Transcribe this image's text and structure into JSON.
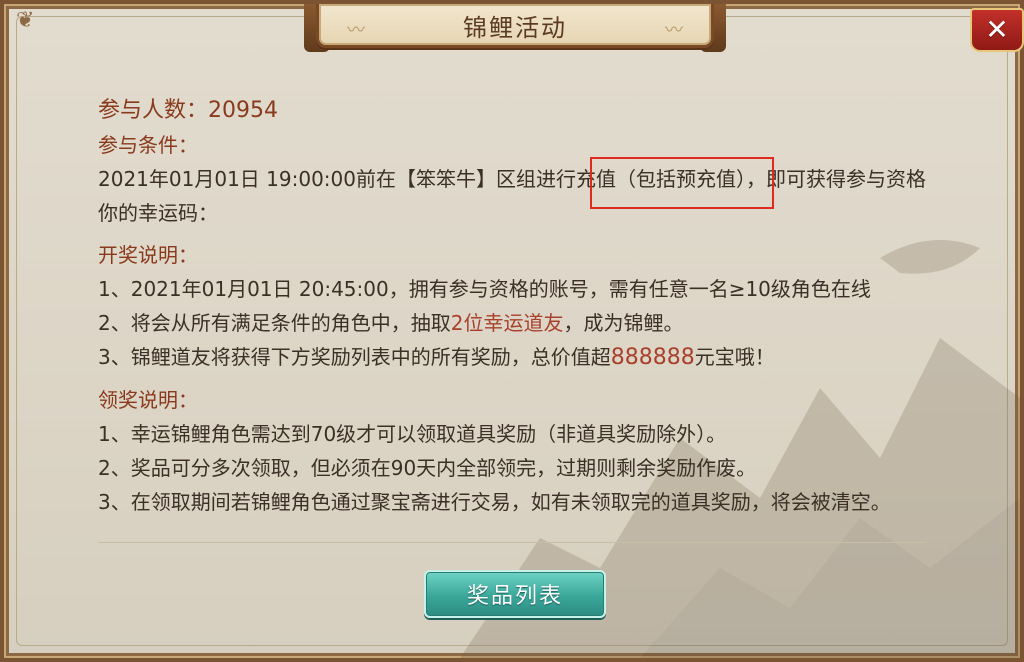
{
  "window": {
    "title": "锦鲤活动",
    "close_icon": "✕"
  },
  "participants": {
    "label": "参与人数：",
    "value": "20954"
  },
  "conditions": {
    "heading": "参与条件：",
    "text_before": "2021年01月01日 19:00:00前在【笨笨牛】区组进行",
    "text_boxed": "充值（包括预充值）",
    "text_after": "，即可获得参与资格",
    "lucky_code": "你的幸运码："
  },
  "draw": {
    "heading": "开奖说明：",
    "line1": "1、2021年01月01日 20:45:00，拥有参与资格的账号，需有任意一名≥10级角色在线",
    "line2_a": "2、将会从所有满足条件的角色中，抽取",
    "line2_hl": "2位幸运道友",
    "line2_b": "，成为锦鲤。",
    "line3_a": "3、锦鲤道友将获得下方奖励列表中的所有奖励，总价值超",
    "line3_hl": "888888",
    "line3_b": "元宝哦！"
  },
  "claim": {
    "heading": "领奖说明：",
    "line1": "1、幸运锦鲤角色需达到70级才可以领取道具奖励（非道具奖励除外）。",
    "line2": "2、奖品可分多次领取，但必须在90天内全部领完，过期则剩余奖励作废。",
    "line3": "3、在领取期间若锦鲤角色通过聚宝斋进行交易，如有未领取完的道具奖励，将会被清空。"
  },
  "buttons": {
    "reward_list": "奖品列表"
  },
  "colors": {
    "heading": "#8a3a1c",
    "highlight": "#a8402a",
    "annotation_box": "#e02a1e",
    "button": "#3aa79a",
    "close": "#c2302a"
  },
  "icons": {
    "close": "close-icon",
    "corner_ornament": "cloud-ornament-icon"
  }
}
